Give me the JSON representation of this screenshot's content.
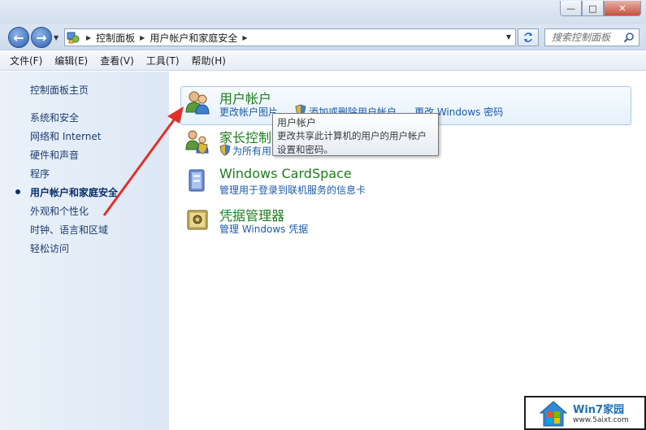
{
  "window": {
    "controls": {
      "minimize": "—",
      "maximize": "□",
      "close": "✕"
    }
  },
  "navbar": {
    "back": "←",
    "forward": "→",
    "breadcrumb": [
      "控制面板",
      "用户帐户和家庭安全"
    ],
    "search_placeholder": "搜索控制面板"
  },
  "menu": [
    "文件(F)",
    "编辑(E)",
    "查看(V)",
    "工具(T)",
    "帮助(H)"
  ],
  "sidebar": {
    "home": "控制面板主页",
    "items": [
      {
        "label": "系统和安全",
        "active": false
      },
      {
        "label": "网络和 Internet",
        "active": false
      },
      {
        "label": "硬件和声音",
        "active": false
      },
      {
        "label": "程序",
        "active": false
      },
      {
        "label": "用户帐户和家庭安全",
        "active": true
      },
      {
        "label": "外观和个性化",
        "active": false
      },
      {
        "label": "时钟、语言和区域",
        "active": false
      },
      {
        "label": "轻松访问",
        "active": false
      }
    ]
  },
  "categories": [
    {
      "title": "用户帐户",
      "icon": "users-icon",
      "links": [
        "更改帐户图片",
        "添加或删除用户帐户",
        "更改 Windows 密码"
      ]
    },
    {
      "title": "家长控制",
      "icon": "parental-controls-icon",
      "links": [
        "为所有用"
      ]
    },
    {
      "title": "Windows CardSpace",
      "icon": "cardspace-icon",
      "links": [
        "管理用于登录到联机服务的信息卡"
      ]
    },
    {
      "title": "凭据管理器",
      "icon": "credential-manager-icon",
      "links": [
        "管理 Windows 凭据"
      ]
    }
  ],
  "tooltip": {
    "title": "用户帐户",
    "body": "更改共享此计算机的用户的用户帐户设置和密码。"
  },
  "watermark": {
    "title": "Win7家园",
    "url": "www.5aixt.com"
  },
  "colors": {
    "accent_green": "#1e7d1e",
    "link_blue": "#1a5aa8",
    "arrow_red": "#e0302a"
  }
}
